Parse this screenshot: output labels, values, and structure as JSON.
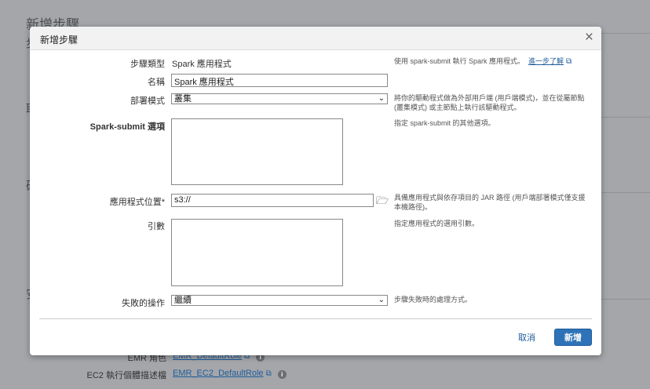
{
  "background": {
    "title": "新增步驟",
    "fragments": [
      "步",
      "取",
      "硬",
      "安"
    ],
    "emr_role_label": "EMR 角色",
    "emr_role_value": "EMR_DefaultRole",
    "ec2_profile_label": "EC2 執行個體描述檔",
    "ec2_profile_value": "EMR_EC2_DefaultRole"
  },
  "dialog": {
    "title": "新增步驟",
    "close_label": "×",
    "step_type": {
      "label": "步驟類型",
      "value": "Spark 應用程式",
      "help": "使用 spark-submit 執行 Spark 應用程式。",
      "help_link": "進一步了解"
    },
    "name": {
      "label": "名稱",
      "value": "Spark 應用程式"
    },
    "deploy_mode": {
      "label": "部署模式",
      "selected": "叢集",
      "help": "將你的驅動程式做為外部用戶端 (用戶端模式)，並在從屬節點 (叢集模式) 或主節點上執行該驅動程式。"
    },
    "spark_submit": {
      "label": "Spark-submit 選項",
      "value": "",
      "help": "指定 spark-submit 的其他選項。"
    },
    "app_location": {
      "label": "應用程式位置*",
      "value": "s3://",
      "help": "具備應用程式與依存項目的 JAR 路徑 (用戶端部署模式僅支援本機路徑)。"
    },
    "arguments": {
      "label": "引數",
      "value": "",
      "help": "指定應用程式的選用引數。"
    },
    "action_on_failure": {
      "label": "失敗的操作",
      "selected": "繼續",
      "help": "步驟失敗時的處理方式。"
    },
    "cancel_label": "取消",
    "add_label": "新增"
  },
  "colors": {
    "accent": "#2e73b8",
    "link": "#1f5d9b",
    "overlay": "#a4a6aa"
  }
}
